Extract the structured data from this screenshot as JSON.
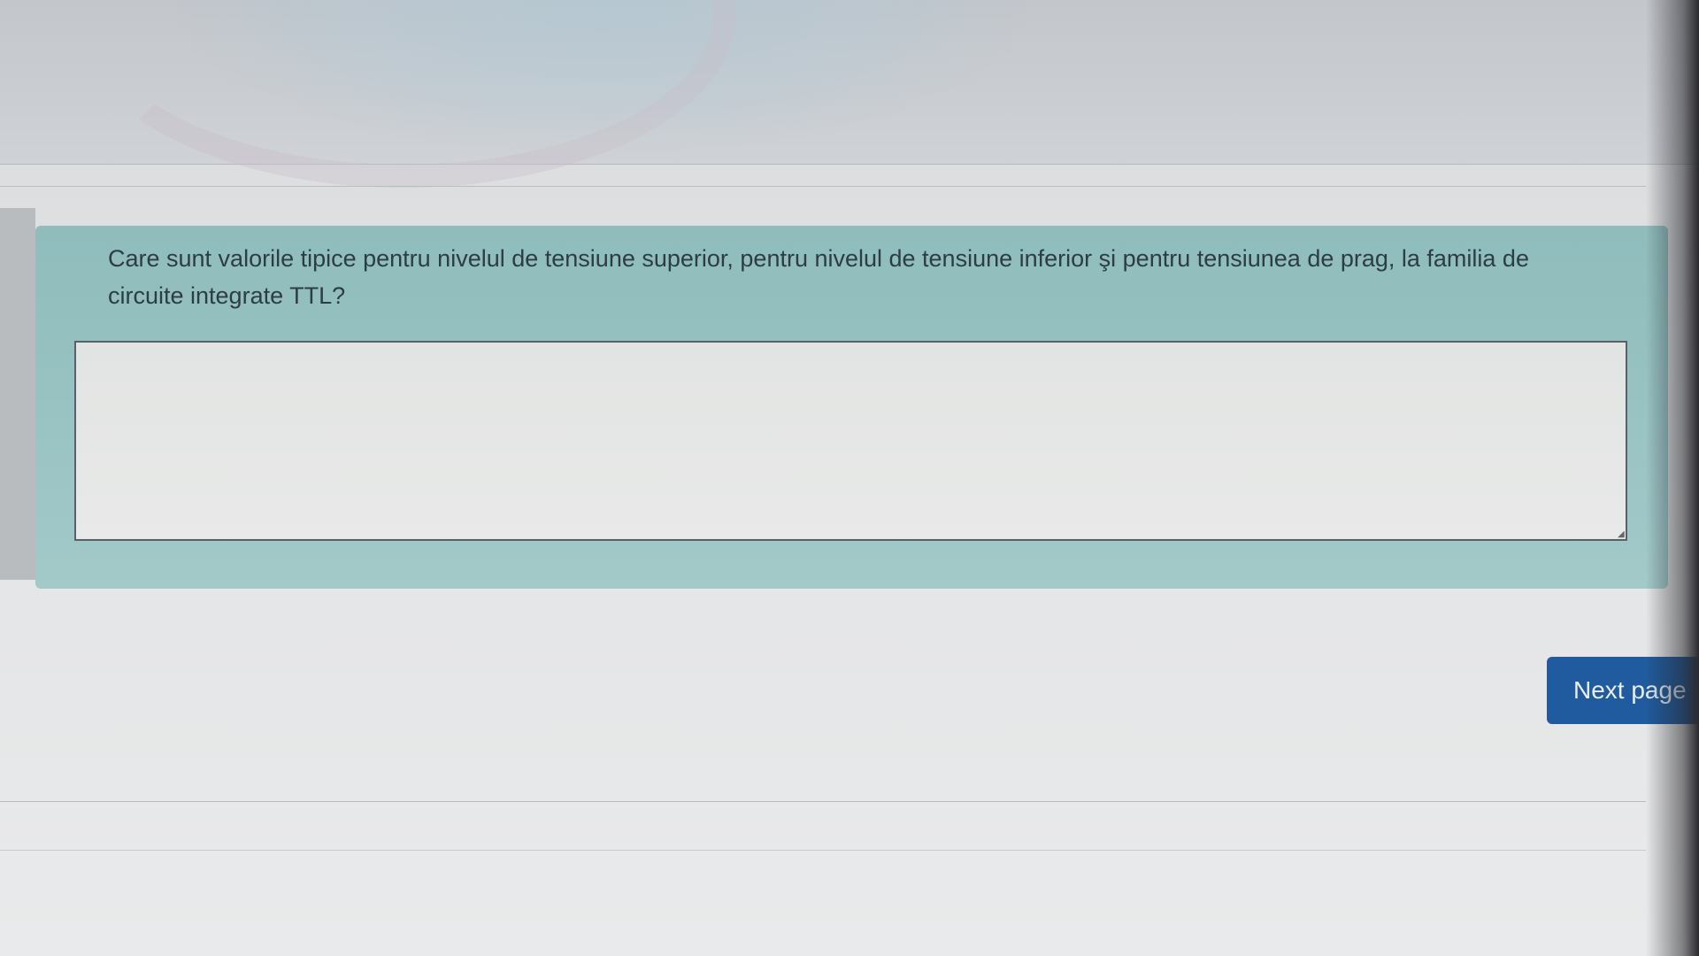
{
  "question": {
    "text": "Care sunt valorile tipice pentru nivelul de tensiune superior, pentru nivelul de  tensiune inferior şi pentru tensiunea de prag, la familia de circuite integrate TTL?"
  },
  "answer": {
    "value": "",
    "placeholder": ""
  },
  "navigation": {
    "next_label": "Next page"
  },
  "colors": {
    "card_background": "#9cc4c4",
    "button_background": "#1f5b9e",
    "question_text": "#2c3d45"
  }
}
